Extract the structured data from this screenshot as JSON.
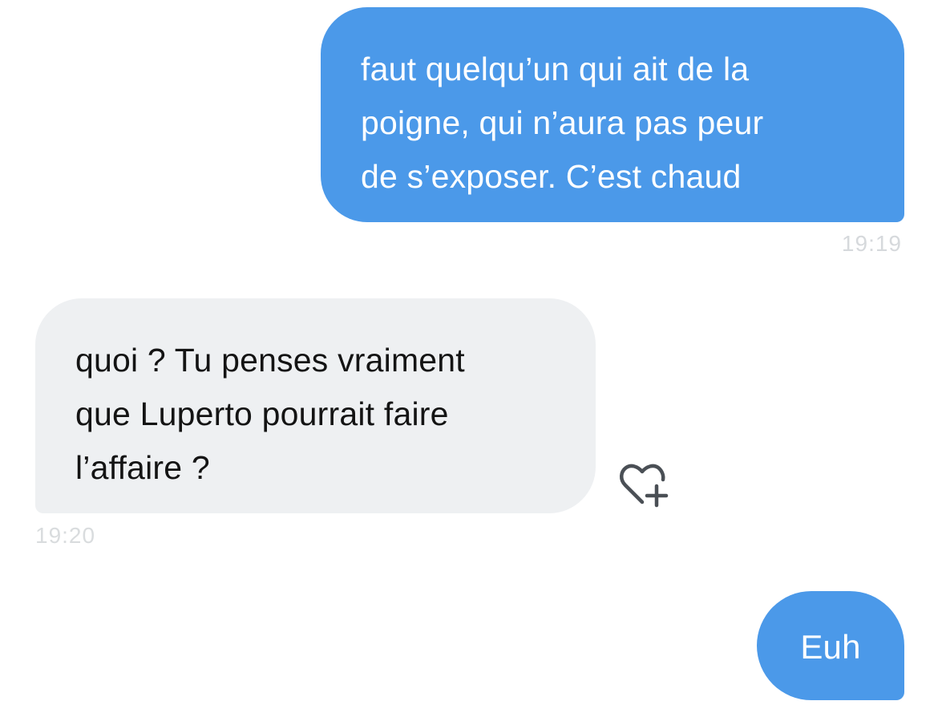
{
  "conversation": {
    "messages": [
      {
        "direction": "sent",
        "text": "faut quelqu’un qui ait de la\npoigne, qui n’aura pas peur\nde s’exposer. C’est chaud",
        "time": "19:19"
      },
      {
        "direction": "received",
        "text": "quoi ? Tu penses vraiment\nque Luperto pourrait faire\nl’affaire ?",
        "time": "19:20"
      },
      {
        "direction": "sent",
        "text": "Euh"
      }
    ],
    "reaction_icon": "heart-plus-icon"
  },
  "colors": {
    "sent_bubble": "#4b99e9",
    "received_bubble": "#eef0f2",
    "received_text": "#141414",
    "timestamp": "#d6d9dc",
    "icon": "#4a4f55"
  }
}
